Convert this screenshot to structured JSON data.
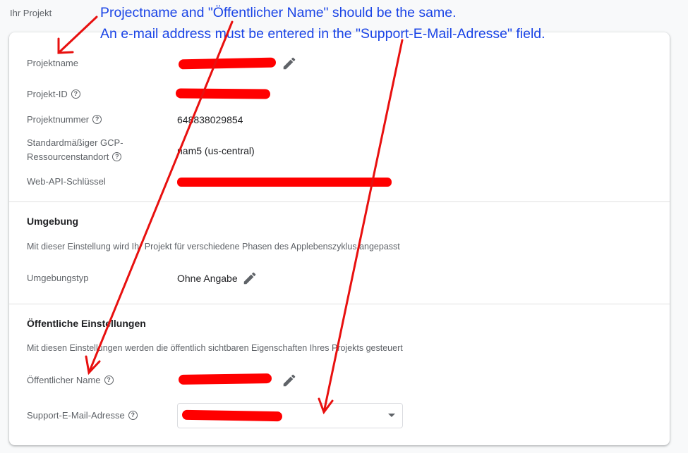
{
  "page": {
    "section_title": "Ihr Projekt"
  },
  "project": {
    "name_label": "Projektname",
    "id_label": "Projekt-ID",
    "number_label": "Projektnummer",
    "number_value": "648838029854",
    "location_label_line1": "Standardmäßiger GCP-",
    "location_label_line2": "Ressourcenstandort",
    "location_value": "nam5 (us-central)",
    "webapi_label": "Web-API-Schlüssel"
  },
  "environment": {
    "heading": "Umgebung",
    "description": "Mit dieser Einstellung wird Ihr Projekt für verschiedene Phasen des Applebenszyklus angepasst",
    "type_label": "Umgebungstyp",
    "type_value": "Ohne Angabe"
  },
  "public": {
    "heading": "Öffentliche Einstellungen",
    "description": "Mit diesen Einstellungen werden die öffentlich sichtbaren Eigenschaften Ihres Projekts gesteuert",
    "name_label": "Öffentlicher Name",
    "support_email_label": "Support-E-Mail-Adresse"
  },
  "annotation": {
    "line1": "Projectname and \"Öffentlicher Name\" should be the same.",
    "line2": "An e-mail address must be entered in the \"Support-E-Mail-Adresse\" field."
  },
  "colors": {
    "redaction": "#ff0000",
    "annotation_text": "#1a44e6",
    "arrow": "#e8100f"
  },
  "icons": {
    "edit": "pencil-icon",
    "help": "help-circle-icon",
    "dropdown": "caret-down-icon"
  }
}
